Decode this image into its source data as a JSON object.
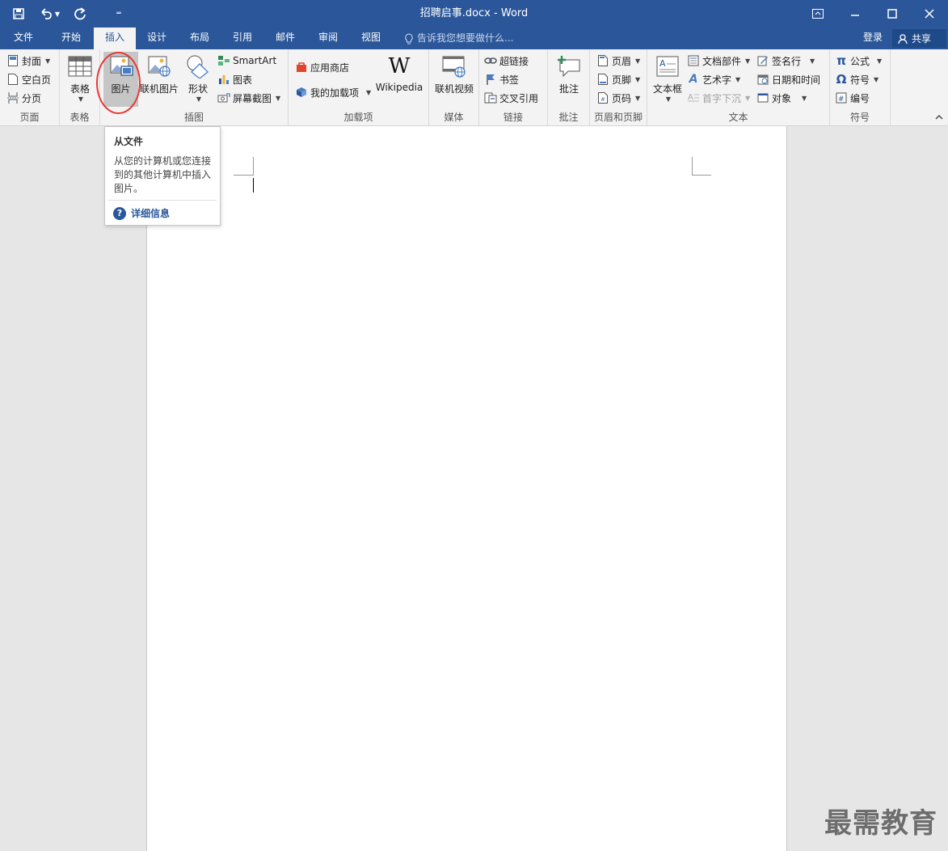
{
  "window": {
    "title": "招聘启事.docx - Word"
  },
  "tabs": [
    {
      "label": "文件"
    },
    {
      "label": "开始"
    },
    {
      "label": "插入",
      "active": true
    },
    {
      "label": "设计"
    },
    {
      "label": "布局"
    },
    {
      "label": "引用"
    },
    {
      "label": "邮件"
    },
    {
      "label": "审阅"
    },
    {
      "label": "视图"
    }
  ],
  "tell_me": "告诉我您想要做什么...",
  "account": {
    "login": "登录",
    "share": "共享"
  },
  "ribbon": {
    "pages": {
      "label": "页面",
      "items": [
        "封面",
        "空白页",
        "分页"
      ]
    },
    "table": {
      "label": "表格",
      "button": "表格"
    },
    "illustrations": {
      "label": "插图",
      "picture": "图片",
      "online_picture": "联机图片",
      "shapes": "形状",
      "smartart": "SmartArt",
      "chart": "图表",
      "screenshot": "屏幕截图"
    },
    "addins": {
      "label": "加载项",
      "store": "应用商店",
      "my_addins": "我的加载项",
      "wikipedia": "Wikipedia"
    },
    "media": {
      "label": "媒体",
      "online_video": "联机视频"
    },
    "links": {
      "label": "链接",
      "hyperlink": "超链接",
      "bookmark": "书签",
      "cross_ref": "交叉引用"
    },
    "comments": {
      "label": "批注",
      "comment": "批注"
    },
    "header_footer": {
      "label": "页眉和页脚",
      "header": "页眉",
      "footer": "页脚",
      "page_number": "页码"
    },
    "text": {
      "label": "文本",
      "textbox": "文本框",
      "quick_parts": "文档部件",
      "wordart": "艺术字",
      "dropcap": "首字下沉",
      "signature": "签名行",
      "datetime": "日期和时间",
      "object": "对象"
    },
    "symbols": {
      "label": "符号",
      "equation": "公式",
      "symbol": "符号",
      "number": "编号"
    }
  },
  "tooltip": {
    "title": "从文件",
    "description": "从您的计算机或您连接到的其他计算机中插入图片。",
    "more_info": "详细信息"
  },
  "watermark": "最需教育",
  "colors": {
    "accent": "#2b579a",
    "highlight_circle": "#e53935"
  }
}
